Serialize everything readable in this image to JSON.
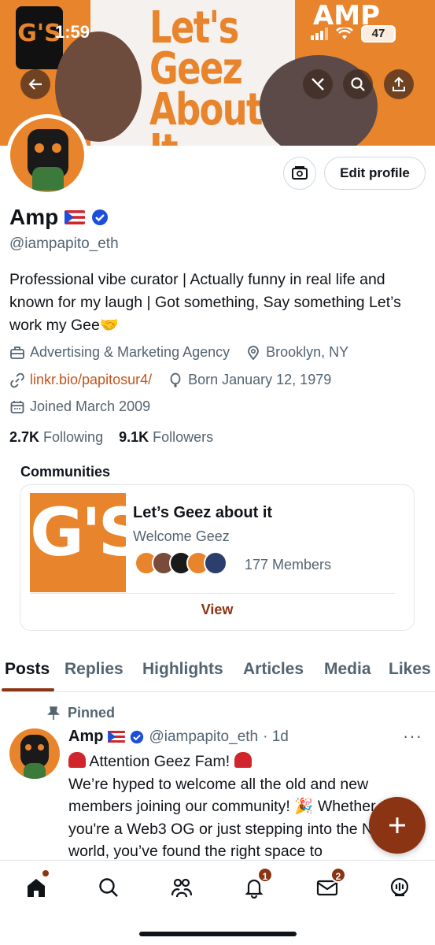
{
  "status_bar": {
    "time": "1:59",
    "battery": "47"
  },
  "banner": {
    "headline": "Let's Geez About It",
    "corner_text": "AMP",
    "logo_text": "G'S ON APE"
  },
  "profile": {
    "name": "Amp",
    "handle": "@iampapito_eth",
    "bio": "Professional vibe curator | Actually funny in real life and known for my laugh | Got something, Say something Let’s work my Gee🤝",
    "category": "Advertising & Marketing Agency",
    "location": "Brooklyn, NY",
    "link": "linkr.bio/papitosur4/",
    "born": "Born January 12, 1979",
    "joined": "Joined March 2009",
    "following_count": "2.7K",
    "following_label": "Following",
    "followers_count": "9.1K",
    "followers_label": "Followers",
    "edit_label": "Edit profile"
  },
  "communities": {
    "title": "Communities",
    "card": {
      "name": "Let’s Geez about it",
      "subtitle": "Welcome Geez",
      "members": "177 Members",
      "view_label": "View",
      "thumb_text": "G'S"
    }
  },
  "tabs": [
    "Posts",
    "Replies",
    "Highlights",
    "Articles",
    "Media",
    "Likes"
  ],
  "post": {
    "pinned_label": "Pinned",
    "name": "Amp",
    "handle": "@iampapito_eth",
    "time": "· 1d",
    "more": "···",
    "line1": "Attention Geez Fam!",
    "line2": "We’re hyped to welcome all the old and new members joining our community! 🎉 Whether you're a Web3 OG or just stepping into the NFT world, you’ve found the right space to"
  },
  "nav": {
    "notifications_badge": "1",
    "messages_badge": "2"
  },
  "colors": {
    "accent": "#8a3414",
    "brand_orange": "#e8842c",
    "verified": "#1d4ed8",
    "muted": "#536471"
  }
}
